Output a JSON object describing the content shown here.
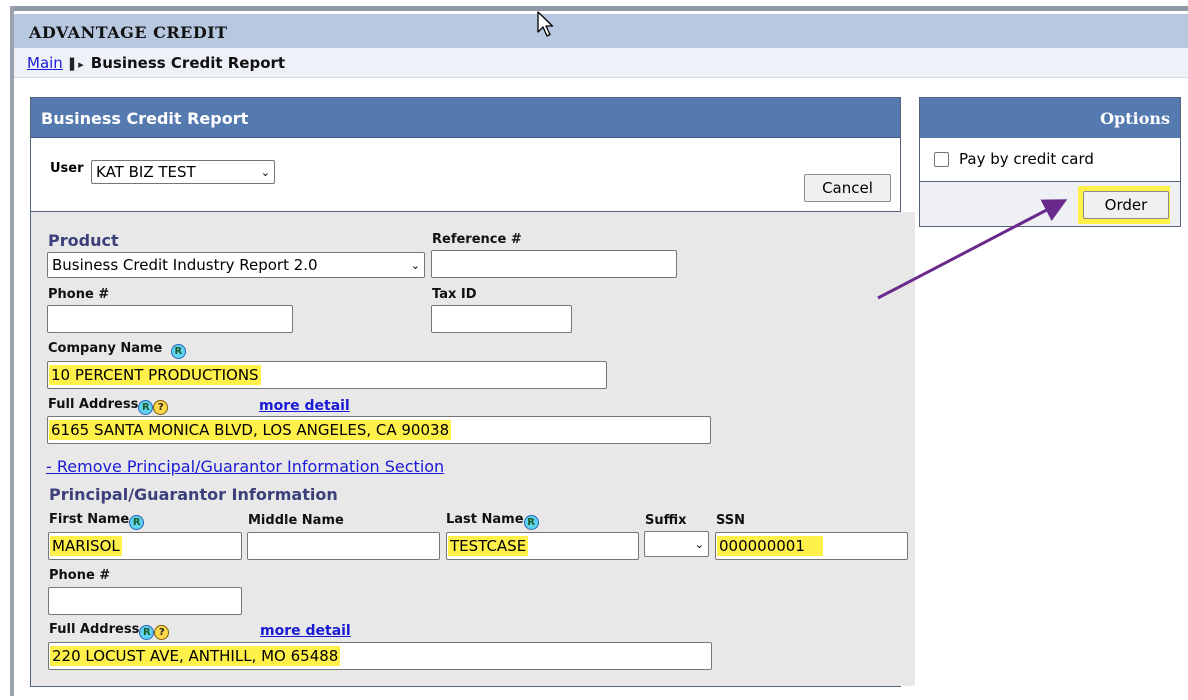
{
  "app": {
    "title": "ADVANTAGE CREDIT"
  },
  "breadcrumb": {
    "main_link": "Main",
    "separator": "▌▸",
    "current": "Business Credit Report"
  },
  "panel": {
    "title": "Business Credit Report",
    "user_label": "User",
    "user_value": "KAT BIZ TEST",
    "cancel_label": "Cancel"
  },
  "form": {
    "product_label": "Product",
    "product_value": "Business Credit Industry Report 2.0",
    "reference_label": "Reference #",
    "reference_value": "",
    "phone_label": "Phone #",
    "phone_value": "",
    "taxid_label": "Tax ID",
    "taxid_value": "",
    "company_label": "Company Name",
    "company_value": "10 PERCENT PRODUCTIONS",
    "address_label": "Full Address",
    "address_value": "6165 SANTA MONICA BLVD, LOS ANGELES, CA 90038",
    "more_detail": "more detail",
    "remove_link": "- Remove Principal/Guarantor Information Section",
    "section_title": "Principal/Guarantor Information",
    "first_name_label": "First Name",
    "first_name_value": "MARISOL",
    "middle_name_label": "Middle Name",
    "middle_name_value": "",
    "last_name_label": "Last Name",
    "last_name_value": "TESTCASE",
    "suffix_label": "Suffix",
    "suffix_value": "",
    "ssn_label": "SSN",
    "ssn_value": "000000001",
    "p_phone_label": "Phone #",
    "p_phone_value": "",
    "p_address_label": "Full Address",
    "p_address_value": "220 LOCUST AVE, ANTHILL, MO 65488",
    "p_more_detail": "more detail",
    "required_icon": "R",
    "help_icon": "?"
  },
  "options": {
    "title": "Options",
    "pay_by_card_label": "Pay by credit card",
    "pay_by_card_checked": false,
    "order_label": "Order"
  },
  "colors": {
    "header_blue": "#557ab0",
    "highlight": "#fff04a",
    "arrow": "#6a2a8c",
    "link": "#1a1ad6"
  }
}
